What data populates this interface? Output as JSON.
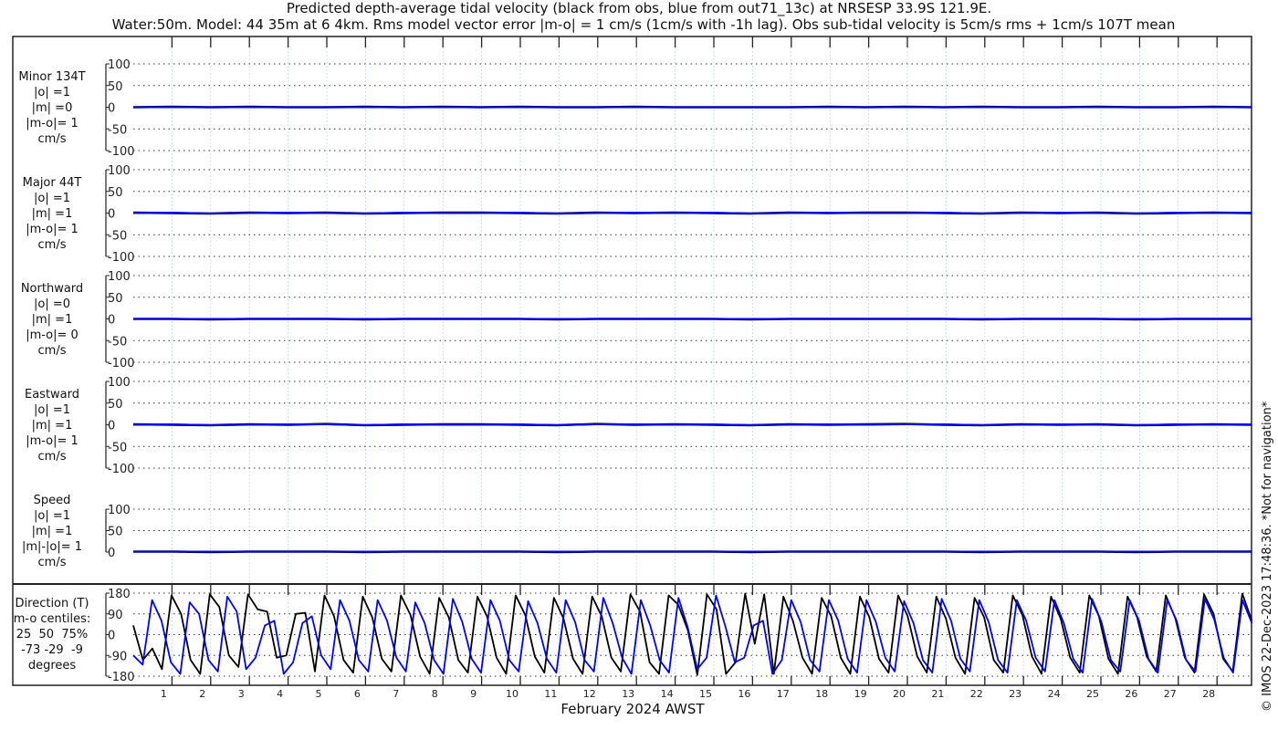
{
  "title": {
    "line1": "Predicted depth-average tidal velocity (black from obs, blue from out71_13c) at NRSESP 33.9S 121.9E.",
    "line2": "Water:50m. Model: 44 35m at 6 4km. Rms model vector error |m-o| = 1 cm/s (1cm/s with -1h lag). Obs sub-tidal velocity is 5cm/s rms + 1cm/s 107T mean"
  },
  "copyright": "© IMOS 22-Dec-2023 17:48:36. *Not for navigation*",
  "colors": {
    "obs": "#000000",
    "model": "#0000ff",
    "grid": "#8fa8d8"
  },
  "chart_data": {
    "type": "line",
    "xlabel": "February 2024 AWST",
    "x_ticks": [
      "1",
      "2",
      "3",
      "4",
      "5",
      "6",
      "7",
      "8",
      "9",
      "10",
      "11",
      "12",
      "13",
      "14",
      "15",
      "16",
      "17",
      "18",
      "19",
      "20",
      "21",
      "22",
      "23",
      "24",
      "25",
      "26",
      "27",
      "28"
    ],
    "x_range_days": [
      0,
      28.9
    ],
    "panels": [
      {
        "name": "minor",
        "labels": [
          "Minor 134T",
          "|o| =1",
          "|m| =0",
          "|m-o|= 1",
          "cm/s"
        ],
        "yticks": [
          "100",
          "50",
          "0",
          "-50",
          "-100"
        ],
        "ylim": [
          -100,
          100
        ],
        "obs": [
          0,
          1,
          0,
          1,
          0,
          0,
          1,
          0,
          1,
          0,
          1,
          0,
          0,
          1,
          0,
          0,
          0,
          0,
          1,
          0,
          1,
          0,
          1,
          0,
          0,
          1,
          0,
          0,
          1,
          0
        ],
        "model": [
          0,
          0,
          0,
          0,
          0,
          0,
          0,
          0,
          0,
          0,
          0,
          0,
          0,
          0,
          0,
          0,
          0,
          0,
          0,
          0,
          0,
          0,
          0,
          0,
          0,
          0,
          0,
          0,
          0,
          0
        ]
      },
      {
        "name": "major",
        "labels": [
          "Major 44T",
          "|o| =1",
          "|m| =1",
          "|m-o|= 1",
          "cm/s"
        ],
        "yticks": [
          "100",
          "50",
          "0",
          "-50",
          "-100"
        ],
        "ylim": [
          -100,
          100
        ],
        "obs": [
          1,
          0,
          -1,
          1,
          0,
          1,
          -1,
          0,
          1,
          1,
          0,
          -1,
          1,
          0,
          1,
          0,
          -1,
          1,
          0,
          1,
          1,
          0,
          -1,
          1,
          0,
          1,
          -1,
          0,
          1,
          0
        ],
        "model": [
          0,
          1,
          -1,
          0,
          1,
          0,
          -1,
          1,
          0,
          0,
          1,
          -1,
          0,
          1,
          0,
          1,
          -1,
          0,
          1,
          0,
          0,
          1,
          -1,
          0,
          1,
          0,
          -1,
          1,
          0,
          1
        ]
      },
      {
        "name": "northward",
        "labels": [
          "Northward",
          "|o| =0",
          "|m| =1",
          "|m-o|= 0",
          "cm/s"
        ],
        "yticks": [
          "100",
          "50",
          "0",
          "-50",
          "-100"
        ],
        "ylim": [
          -100,
          100
        ],
        "obs": [
          0,
          0,
          -1,
          0,
          0,
          0,
          -1,
          0,
          0,
          0,
          0,
          -1,
          0,
          0,
          0,
          0,
          -1,
          0,
          0,
          0,
          0,
          0,
          -1,
          0,
          0,
          0,
          -1,
          0,
          0,
          0
        ],
        "model": [
          0,
          0,
          0,
          0,
          0,
          0,
          0,
          0,
          0,
          0,
          0,
          0,
          0,
          0,
          0,
          0,
          0,
          0,
          0,
          0,
          0,
          0,
          0,
          0,
          0,
          0,
          0,
          0,
          0,
          0
        ]
      },
      {
        "name": "eastward",
        "labels": [
          "Eastward",
          "|o| =1",
          "|m| =1",
          "|m-o|= 1",
          "cm/s"
        ],
        "yticks": [
          "100",
          "50",
          "0",
          "-50",
          "-100"
        ],
        "ylim": [
          -100,
          100
        ],
        "obs": [
          1,
          0,
          -1,
          1,
          0,
          2,
          -1,
          0,
          1,
          1,
          0,
          -1,
          2,
          0,
          1,
          0,
          -1,
          1,
          0,
          1,
          2,
          0,
          -1,
          1,
          0,
          1,
          -1,
          0,
          1,
          0
        ],
        "model": [
          0,
          1,
          -1,
          0,
          1,
          1,
          -1,
          1,
          0,
          0,
          1,
          -1,
          1,
          1,
          0,
          1,
          -1,
          0,
          1,
          0,
          1,
          1,
          -1,
          0,
          1,
          0,
          -1,
          1,
          0,
          1
        ]
      },
      {
        "name": "speed",
        "labels": [
          "Speed",
          "|o| =1",
          "|m| =1",
          "|m|-|o|= 1",
          "cm/s"
        ],
        "yticks": [
          "100",
          "50",
          "0"
        ],
        "ylim": [
          0,
          100
        ],
        "obs": [
          1,
          1,
          0,
          1,
          1,
          1,
          0,
          1,
          1,
          1,
          1,
          0,
          1,
          1,
          1,
          1,
          0,
          1,
          1,
          1,
          1,
          1,
          0,
          1,
          1,
          1,
          0,
          1,
          1,
          1
        ],
        "model": [
          1,
          1,
          1,
          1,
          1,
          1,
          1,
          1,
          1,
          1,
          1,
          1,
          1,
          1,
          1,
          1,
          1,
          1,
          1,
          1,
          1,
          1,
          1,
          1,
          1,
          1,
          1,
          1,
          1,
          1
        ]
      },
      {
        "name": "direction",
        "labels": [
          "Direction (T)",
          "m-o centiles:",
          "25  50  75%",
          "-73 -29  -9",
          "degrees"
        ],
        "yticks": [
          "180",
          "90",
          "0",
          "-90",
          "-180"
        ],
        "ylim": [
          -180,
          180
        ],
        "obs": [
          40,
          -110,
          -60,
          -150,
          170,
          90,
          -110,
          -170,
          175,
          120,
          -90,
          -140,
          175,
          110,
          100,
          -100,
          -90,
          90,
          95,
          -160,
          170,
          80,
          -110,
          -165,
          165,
          75,
          -105,
          -160,
          170,
          85,
          -95,
          -170,
          160,
          75,
          -110,
          -165,
          165,
          80,
          -100,
          -170,
          170,
          85,
          -95,
          -165,
          160,
          70,
          -105,
          -170,
          165,
          80,
          -100,
          -160,
          175,
          100,
          -120,
          -170,
          170,
          130,
          20,
          -175,
          175,
          110,
          -170,
          -120,
          178,
          -40,
          175,
          -170,
          165,
          60,
          -100,
          -170,
          160,
          80,
          -100,
          -170,
          165,
          75,
          -105,
          -165,
          170,
          80,
          -95,
          -165,
          165,
          70,
          -100,
          -170,
          160,
          75,
          -110,
          -165,
          170,
          85,
          -95,
          -170,
          165,
          70,
          -100,
          -165,
          170,
          80,
          -105,
          -170,
          165,
          75,
          -95,
          -160,
          170,
          70,
          -100,
          -165,
          175,
          90,
          -105,
          -160,
          178,
          60
        ],
        "model": [
          -90,
          -130,
          150,
          60,
          -120,
          -170,
          140,
          90,
          -110,
          -160,
          165,
          100,
          -150,
          -100,
          40,
          60,
          -170,
          -120,
          50,
          80,
          -90,
          -150,
          150,
          60,
          -110,
          -160,
          150,
          60,
          -100,
          -160,
          140,
          50,
          -110,
          -170,
          155,
          55,
          -105,
          -165,
          150,
          60,
          -110,
          -160,
          145,
          50,
          -105,
          -165,
          150,
          55,
          -110,
          -160,
          160,
          50,
          -100,
          -170,
          150,
          40,
          -110,
          -165,
          160,
          30,
          -150,
          -100,
          170,
          35,
          -120,
          -100,
          40,
          60,
          -170,
          -110,
          150,
          55,
          -110,
          -160,
          150,
          60,
          -105,
          -165,
          150,
          55,
          -100,
          -160,
          145,
          50,
          -110,
          -165,
          155,
          60,
          -105,
          -160,
          150,
          55,
          -110,
          -165,
          150,
          60,
          -100,
          -160,
          150,
          50,
          -105,
          -165,
          155,
          55,
          -110,
          -160,
          150,
          60,
          -105,
          -165,
          150,
          60,
          -110,
          -160,
          155,
          65,
          -100,
          -165,
          150,
          50
        ]
      }
    ]
  }
}
